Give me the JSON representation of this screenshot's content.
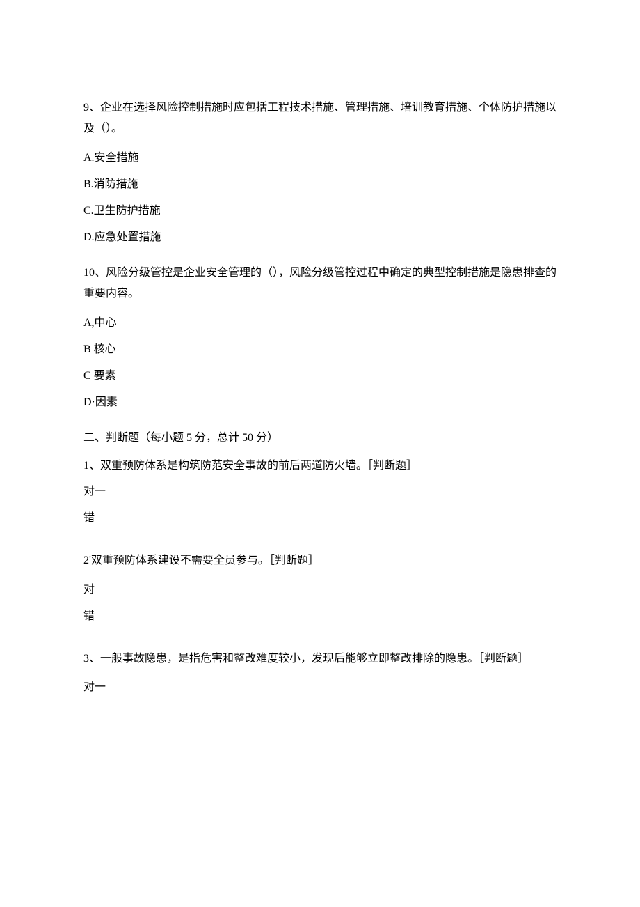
{
  "q9": {
    "text": "9、企业在选择风险控制措施时应包括工程技术措施、管理措施、培训教育措施、个体防护措施以及（）。",
    "options": {
      "a": "A.安全措施",
      "b": "B.消防措施",
      "c": "C.卫生防护措施",
      "d": "D.应急处置措施"
    }
  },
  "q10": {
    "text": "10、风险分级管控是企业安全管理的（），风险分级管控过程中确定的典型控制措施是隐患排查的重要内容。",
    "options": {
      "a": "A,中心",
      "b": "B 核心",
      "c": "C 要素",
      "d": "D·因素"
    }
  },
  "section2": {
    "title": "二、判断题（每小题 5 分，总计 50 分）"
  },
  "j1": {
    "text": "1、双重预防体系是构筑防范安全事故的前后两道防火墙。［判断题］",
    "opt_true": "对一",
    "opt_false": "错"
  },
  "j2": {
    "text": "2'双重预防体系建设不需要全员参与。［判断题］",
    "opt_true": "对",
    "opt_false": "错"
  },
  "j3": {
    "text": "3、一般事故隐患，是指危害和整改难度较小，发现后能够立即整改排除的隐患。［判断题］",
    "opt_true": "对一"
  }
}
